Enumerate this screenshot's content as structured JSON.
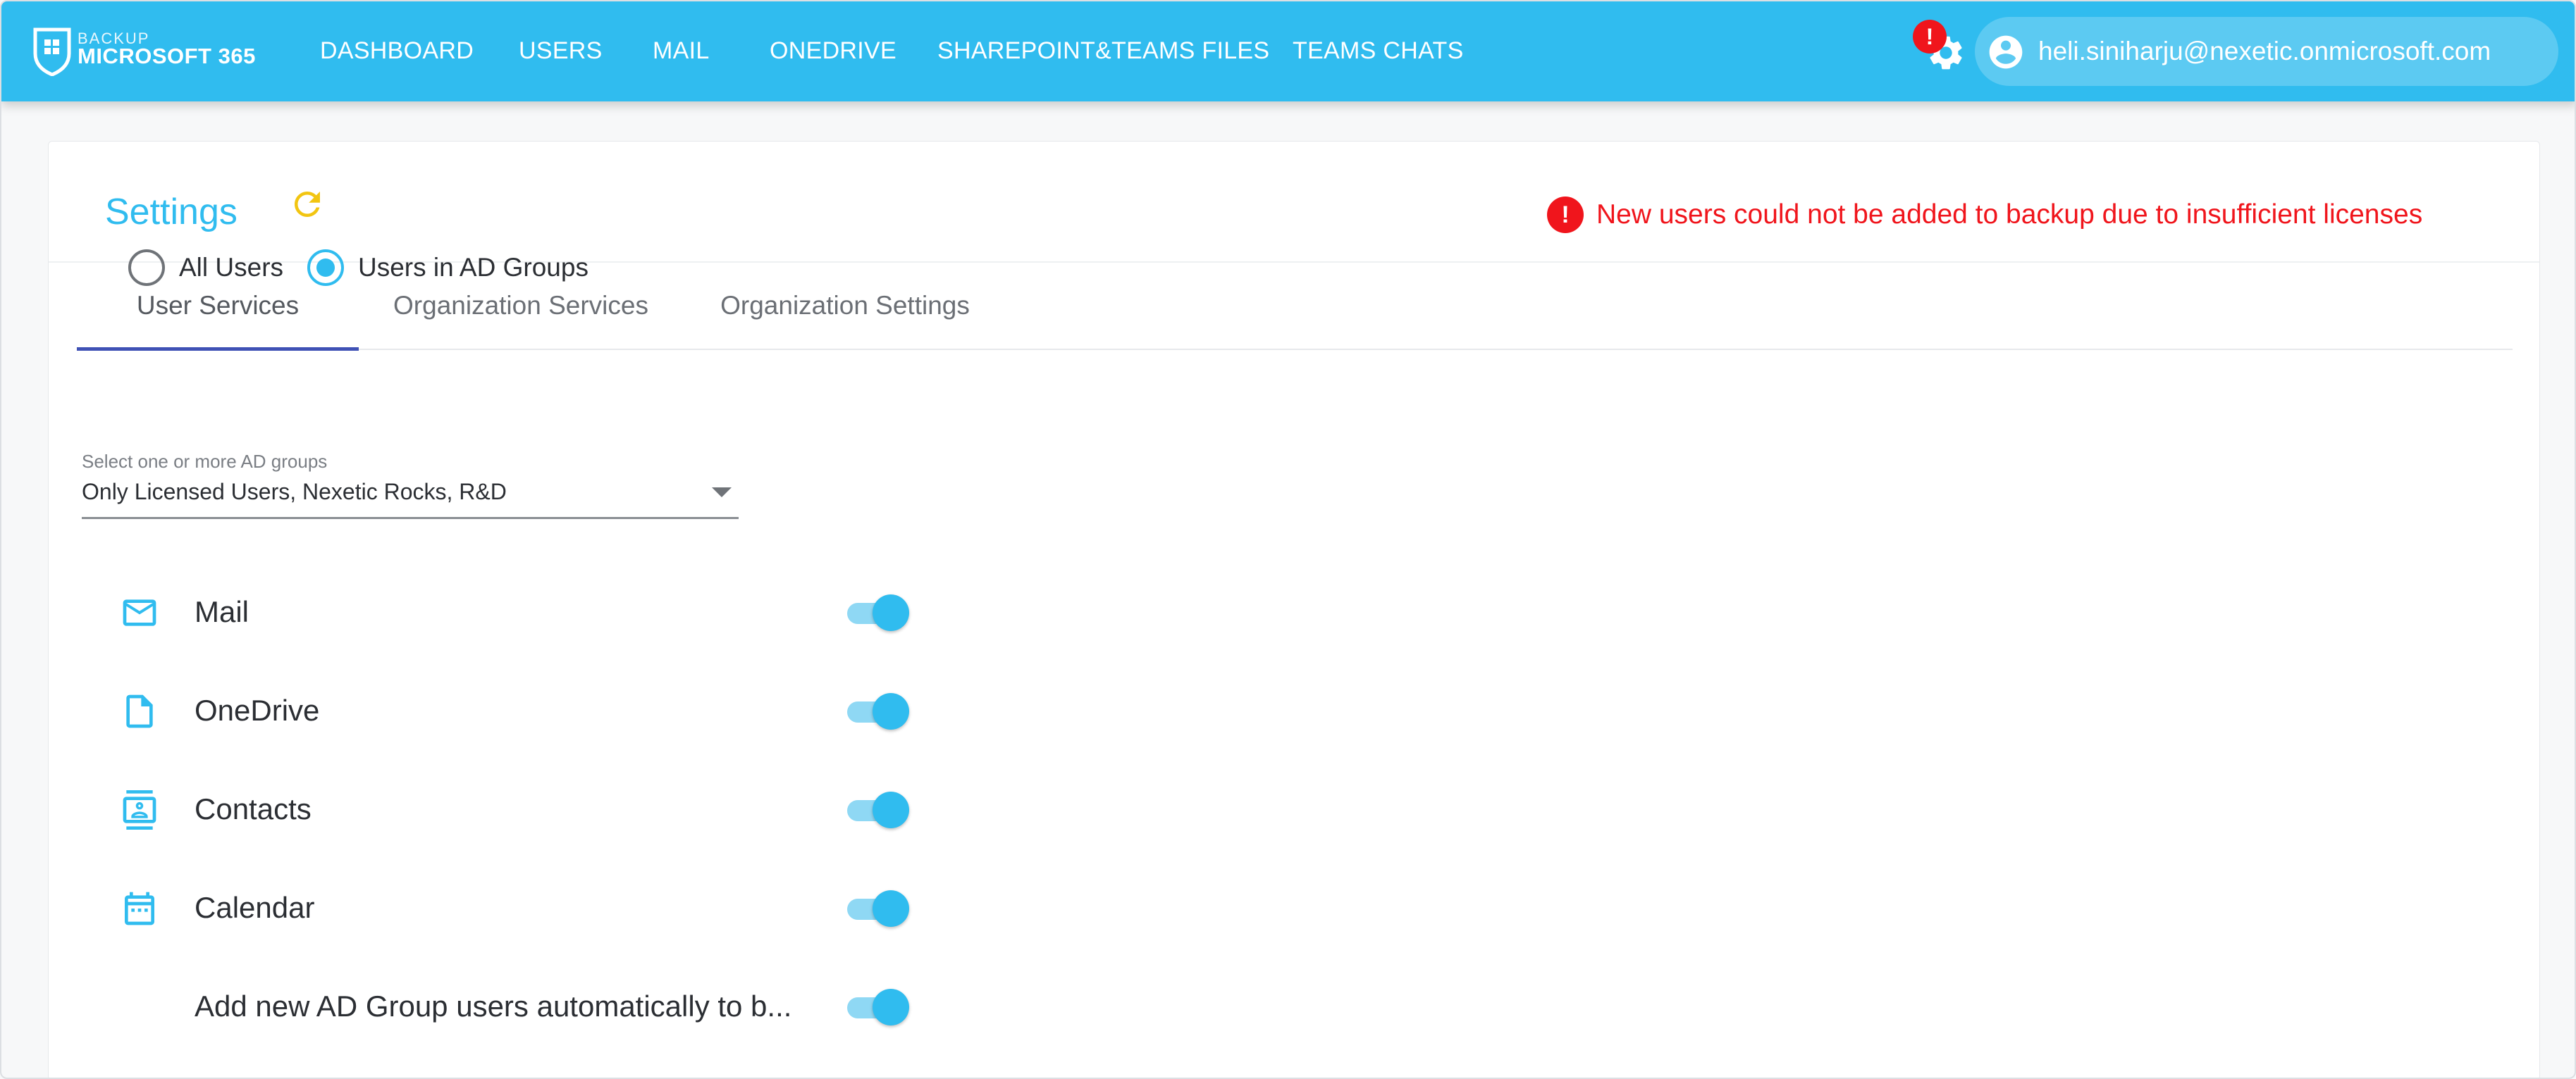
{
  "app": {
    "logo_small": "BACKUP",
    "logo_big": "MICROSOFT 365"
  },
  "nav": {
    "items": [
      {
        "label": "DASHBOARD"
      },
      {
        "label": "USERS"
      },
      {
        "label": "MAIL"
      },
      {
        "label": "ONEDRIVE"
      },
      {
        "label": "SHAREPOINT&TEAMS FILES"
      },
      {
        "label": "TEAMS CHATS"
      }
    ]
  },
  "header": {
    "settings_badge": "!",
    "user_email": "heli.siniharju@nexetic.onmicrosoft.com"
  },
  "page": {
    "title": "Settings",
    "alert_badge": "!",
    "alert_message": "New users could not be added to backup due to insufficient licenses"
  },
  "tabs": [
    {
      "label": "User Services",
      "active": true
    },
    {
      "label": "Organization Services",
      "active": false
    },
    {
      "label": "Organization Settings",
      "active": false
    }
  ],
  "scope": {
    "options": [
      {
        "label": "All Users",
        "checked": false
      },
      {
        "label": "Users in AD Groups",
        "checked": true
      }
    ]
  },
  "ad_groups": {
    "label": "Select one or more AD groups",
    "value": "Only Licensed Users, Nexetic Rocks, R&D"
  },
  "services": [
    {
      "label": "Mail",
      "icon": "mail-icon",
      "enabled": true
    },
    {
      "label": "OneDrive",
      "icon": "file-icon",
      "enabled": true
    },
    {
      "label": "Contacts",
      "icon": "contacts-icon",
      "enabled": true
    },
    {
      "label": "Calendar",
      "icon": "calendar-icon",
      "enabled": true
    },
    {
      "label": "Add new AD Group users automatically to b...",
      "icon": "",
      "enabled": true
    }
  ],
  "colors": {
    "accent": "#30bcef",
    "alert": "#f0151c",
    "tab_indicator": "#3f51b5",
    "refresh": "#f2c511"
  }
}
